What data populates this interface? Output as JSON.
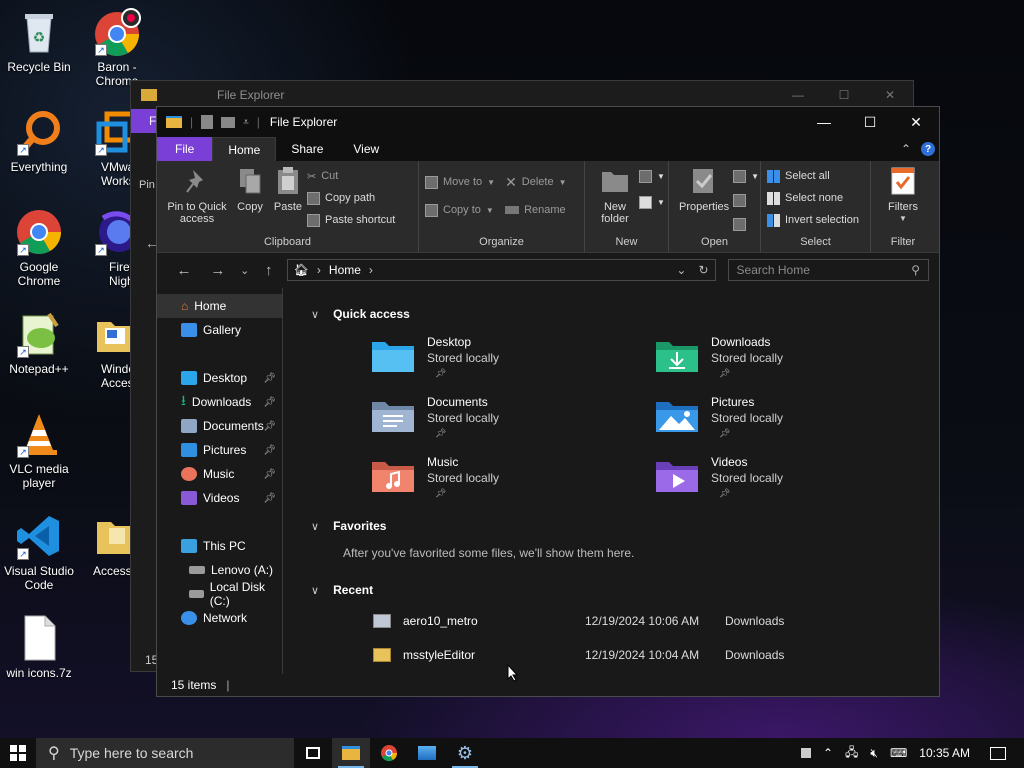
{
  "desktop": {
    "icons": [
      {
        "label": "Recycle Bin"
      },
      {
        "label": "Baron - Chrome"
      },
      {
        "label": "Everything"
      },
      {
        "label": "VMware Workstation"
      },
      {
        "label": "Google Chrome"
      },
      {
        "label": "Firefox Nightly"
      },
      {
        "label": "Notepad++"
      },
      {
        "label": "Windows Accessories"
      },
      {
        "label": "VLC media player"
      },
      {
        "label": "Accessibility"
      },
      {
        "label": "Visual Studio Code"
      },
      {
        "label": "win icons.7z"
      }
    ]
  },
  "back_window": {
    "title": "File Explorer",
    "tab": "Fi",
    "pin": "Pin",
    "status": "15"
  },
  "window": {
    "title": "File Explorer",
    "tabs": [
      "File",
      "Home",
      "Share",
      "View"
    ],
    "ribbon": {
      "clipboard": {
        "name": "Clipboard",
        "pin": "Pin to Quick access",
        "copy": "Copy",
        "paste": "Paste",
        "cut": "Cut",
        "copy_path": "Copy path",
        "paste_shortcut": "Paste shortcut"
      },
      "organize": {
        "name": "Organize",
        "move_to": "Move to",
        "copy_to": "Copy to",
        "delete": "Delete",
        "rename": "Rename"
      },
      "new": {
        "name": "New",
        "new_folder": "New folder"
      },
      "open": {
        "name": "Open",
        "properties": "Properties"
      },
      "select": {
        "name": "Select",
        "select_all": "Select all",
        "select_none": "Select none",
        "invert": "Invert selection"
      },
      "filter": {
        "name": "Filter",
        "filters": "Filters"
      }
    },
    "address": {
      "location": "Home",
      "search_placeholder": "Search Home"
    },
    "sidebar": {
      "home": "Home",
      "gallery": "Gallery",
      "pinned": [
        "Desktop",
        "Downloads",
        "Documents",
        "Pictures",
        "Music",
        "Videos"
      ],
      "this_pc": "This PC",
      "drives": [
        "Lenovo (A:)",
        "Local Disk (C:)"
      ],
      "network": "Network"
    },
    "content": {
      "quick_access": "Quick access",
      "folders": [
        {
          "name": "Desktop",
          "sub": "Stored locally",
          "color": "#2ba6e8"
        },
        {
          "name": "Downloads",
          "sub": "Stored locally",
          "color": "#22b37a"
        },
        {
          "name": "Documents",
          "sub": "Stored locally",
          "color": "#8fa6c4"
        },
        {
          "name": "Pictures",
          "sub": "Stored locally",
          "color": "#2f8fe0"
        },
        {
          "name": "Music",
          "sub": "Stored locally",
          "color": "#e8735a"
        },
        {
          "name": "Videos",
          "sub": "Stored locally",
          "color": "#8a5ad6"
        }
      ],
      "favorites": "Favorites",
      "favorites_empty": "After you've favorited some files, we'll show them here.",
      "recent": "Recent",
      "recent_items": [
        {
          "name": "aero10_metro",
          "date": "12/19/2024 10:06 AM",
          "location": "Downloads"
        },
        {
          "name": "msstyleEditor",
          "date": "12/19/2024 10:04 AM",
          "location": "Downloads"
        }
      ]
    },
    "status": "15 items"
  },
  "taskbar": {
    "search_placeholder": "Type here to search",
    "time": "10:35 AM"
  }
}
